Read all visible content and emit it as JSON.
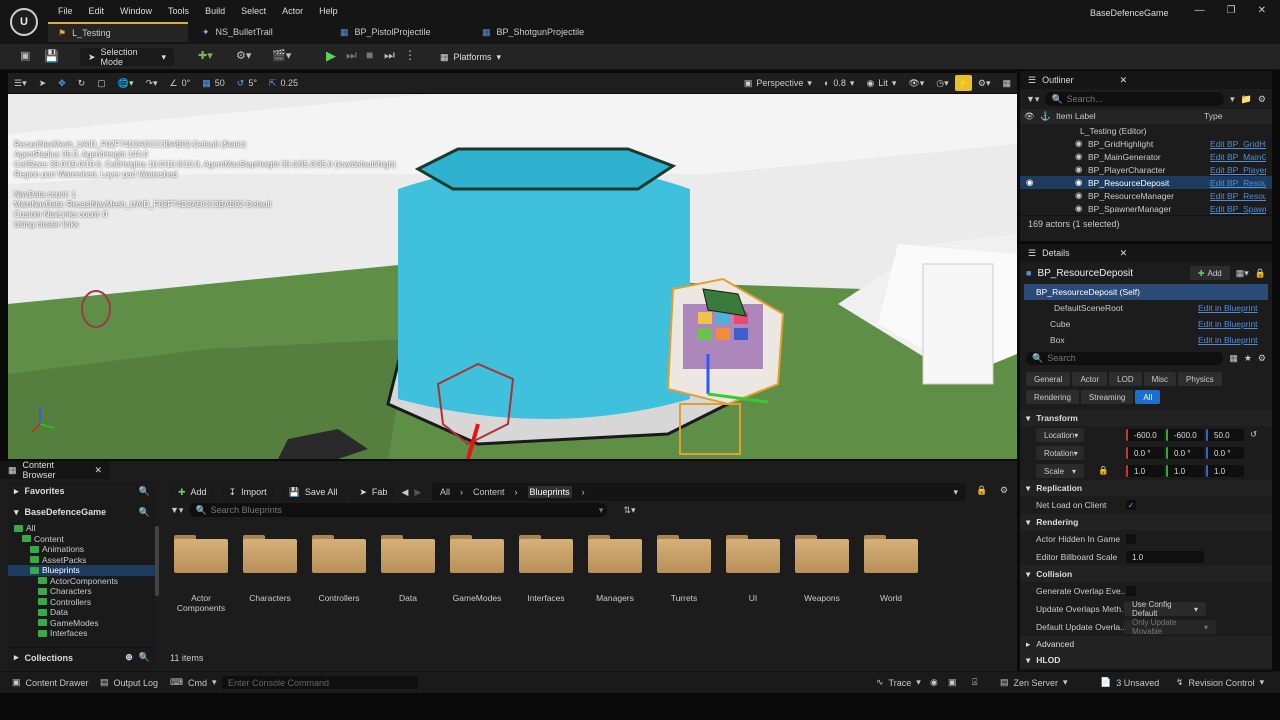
{
  "app": {
    "project_name": "BaseDefenceGame",
    "menu": [
      "File",
      "Edit",
      "Window",
      "Tools",
      "Build",
      "Select",
      "Actor",
      "Help"
    ],
    "tabs": [
      {
        "label": "L_Testing",
        "active": true
      },
      {
        "label": "NS_BulletTrail",
        "active": false
      },
      {
        "label": "BP_PistolProjectile",
        "active": false
      },
      {
        "label": "BP_ShotgunProjectile",
        "active": false
      }
    ]
  },
  "toolbar": {
    "mode": "Selection Mode",
    "platforms": "Platforms"
  },
  "viewport_toolbar": {
    "rotate_snap_val": "0°",
    "grid_snap": "50",
    "rot_snap": "5°",
    "scale_snap": "0.25",
    "perspective": "Perspective",
    "fov": "0.8",
    "lit": "Lit"
  },
  "viewport_stats": [
    "RecastNavMesh_UAID_F02F74D2ADCC3BAB02-Default (Static)",
    "AgentRadius 35.0, AgentHeight 144.0",
    "CellSizes 38.0/19.0/19.0, CellHeights 10.0/10.0/10.0, AgentMaxStepHeight 35.0/35.0/35.0 (low/default/high)",
    "Region part Watershed, Layer part Watershed",
    "",
    "NavData count: 1",
    "MainNavData: RecastNavMesh_UAID_F02F74D2ADCC3BAB02-Default",
    "Custom NavLinks count: 0",
    "Using cluster links"
  ],
  "outliner": {
    "title": "Outliner",
    "search_placeholder": "Search...",
    "col_label": "Item Label",
    "col_type": "Type",
    "root": "L_Testing (Editor)",
    "items": [
      {
        "label": "BP_GridHighlight",
        "type": "Edit BP_GridHi",
        "selected": false
      },
      {
        "label": "BP_MainGenerator",
        "type": "Edit BP_MainG",
        "selected": false
      },
      {
        "label": "BP_PlayerCharacter",
        "type": "Edit BP_Player",
        "selected": false
      },
      {
        "label": "BP_ResourceDeposit",
        "type": "Edit BP_Resou",
        "selected": true
      },
      {
        "label": "BP_ResourceManager",
        "type": "Edit BP_Resou",
        "selected": false
      },
      {
        "label": "BP_SpawnerManager",
        "type": "Edit BP_Spawn",
        "selected": false
      }
    ],
    "count": "169 actors (1 selected)"
  },
  "details": {
    "title": "Details",
    "actor_name": "BP_ResourceDeposit",
    "add_label": "Add",
    "components": [
      {
        "label": "BP_ResourceDeposit (Self)",
        "link": ""
      },
      {
        "label": "DefaultSceneRoot",
        "link": "Edit in Blueprint"
      },
      {
        "label": "Cube",
        "link": "Edit in Blueprint"
      },
      {
        "label": "Box",
        "link": "Edit in Blueprint"
      }
    ],
    "search_placeholder": "Search",
    "filters_row1": [
      "General",
      "Actor",
      "LOD",
      "Misc",
      "Physics"
    ],
    "filters_row2": [
      "Rendering",
      "Streaming",
      "All"
    ],
    "active_filter": "All",
    "sections": {
      "transform": "Transform",
      "replication": "Replication",
      "rendering": "Rendering",
      "collision": "Collision",
      "advanced": "Advanced",
      "hlod": "HLOD"
    },
    "location": {
      "label": "Location",
      "x": "-600.0",
      "y": "-600.0",
      "z": "50.0"
    },
    "rotation": {
      "label": "Rotation",
      "x": "0.0 °",
      "y": "0.0 °",
      "z": "0.0 °"
    },
    "scale": {
      "label": "Scale",
      "x": "1.0",
      "y": "1.0",
      "z": "1.0"
    },
    "net_load": "Net Load on Client",
    "actor_hidden": "Actor Hidden In Game",
    "billboard_scale_label": "Editor Billboard Scale",
    "billboard_scale": "1.0",
    "gen_overlap": "Generate Overlap Eve...",
    "update_overlap_label": "Update Overlaps Meth...",
    "update_overlap_val": "Use Config Default",
    "default_overlap_label": "Default Update Overla...",
    "default_overlap_val": "Only Update Movable"
  },
  "content_browser": {
    "tab": "Content Browser",
    "favorites": "Favorites",
    "project": "BaseDefenceGame",
    "collections": "Collections",
    "add": "Add",
    "import": "Import",
    "save_all": "Save All",
    "fab": "Fab",
    "breadcrumb": [
      "All",
      "Content",
      "Blueprints"
    ],
    "search_placeholder": "Search Blueprints",
    "tree": [
      {
        "label": "All",
        "depth": 0
      },
      {
        "label": "Content",
        "depth": 1
      },
      {
        "label": "Animations",
        "depth": 2
      },
      {
        "label": "AssetPacks",
        "depth": 2
      },
      {
        "label": "Blueprints",
        "depth": 2
      },
      {
        "label": "ActorComponents",
        "depth": 3
      },
      {
        "label": "Characters",
        "depth": 3
      },
      {
        "label": "Controllers",
        "depth": 3
      },
      {
        "label": "Data",
        "depth": 3
      },
      {
        "label": "GameModes",
        "depth": 3
      },
      {
        "label": "Interfaces",
        "depth": 3
      }
    ],
    "folders": [
      "Actor\nComponents",
      "Characters",
      "Controllers",
      "Data",
      "GameModes",
      "Interfaces",
      "Managers",
      "Turrets",
      "UI",
      "Weapons",
      "World"
    ],
    "item_count": "11 items"
  },
  "statusbar": {
    "content_drawer": "Content Drawer",
    "output_log": "Output Log",
    "cmd": "Cmd",
    "console_placeholder": "Enter Console Command",
    "trace": "Trace",
    "zen": "Zen Server",
    "unsaved": "3 Unsaved",
    "revision": "Revision Control"
  }
}
